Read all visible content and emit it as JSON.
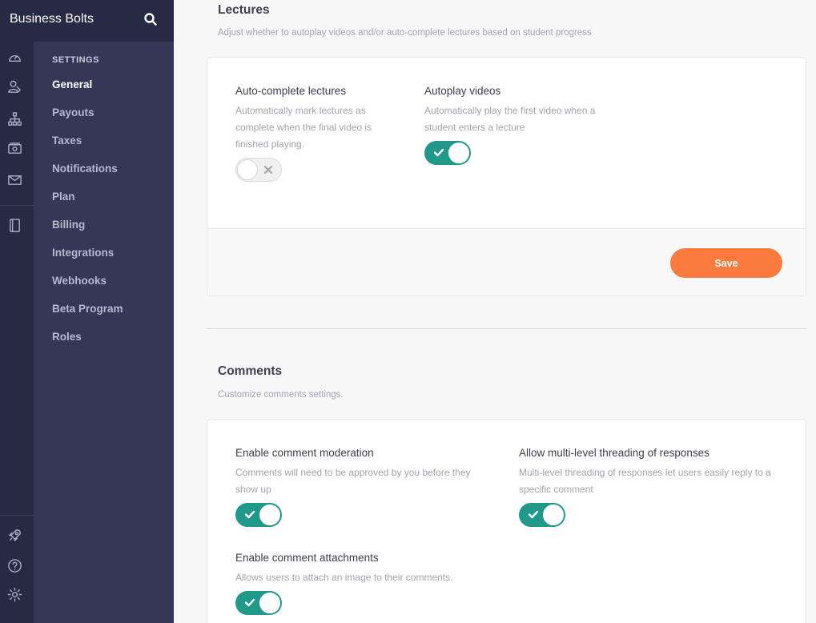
{
  "app": {
    "brand_name": "Business Bolts",
    "search_icon": "search-icon"
  },
  "rail": {
    "top_icons": [
      "dashboard-icon",
      "users-icon",
      "sitemap-icon",
      "money-icon",
      "mail-icon",
      "book-icon"
    ],
    "bottom_icons": [
      "rocket-icon",
      "help-icon",
      "gear-icon"
    ]
  },
  "menu": {
    "heading": "SETTINGS",
    "items": [
      {
        "label": "General",
        "active": true
      },
      {
        "label": "Payouts",
        "active": false
      },
      {
        "label": "Taxes",
        "active": false
      },
      {
        "label": "Notifications",
        "active": false
      },
      {
        "label": "Plan",
        "active": false
      },
      {
        "label": "Billing",
        "active": false
      },
      {
        "label": "Integrations",
        "active": false
      },
      {
        "label": "Webhooks",
        "active": false
      },
      {
        "label": "Beta Program",
        "active": false
      },
      {
        "label": "Roles",
        "active": false
      }
    ]
  },
  "lectures": {
    "title": "Lectures",
    "description": "Adjust whether to autoplay videos and/or auto-complete lectures based on student progress",
    "auto_complete": {
      "label": "Auto-complete lectures",
      "description": "Automatically mark lectures as complete when the final video is finished playing.",
      "enabled": false
    },
    "autoplay": {
      "label": "Autoplay videos",
      "description": "Automatically play the first video when a student enters a lecture",
      "enabled": true
    },
    "save_label": "Save"
  },
  "comments": {
    "title": "Comments",
    "description": "Customize comments settings.",
    "moderation": {
      "label": "Enable comment moderation",
      "description": "Comments will need to be approved by you before they show up",
      "enabled": true
    },
    "threading": {
      "label": "Allow multi-level threading of responses",
      "description": "Multi-level threading of responses let users easily reply to a specific comment",
      "enabled": true
    },
    "attachments": {
      "label": "Enable comment attachments",
      "description": "Allows users to attach an image to their comments.",
      "enabled": true
    }
  },
  "colors": {
    "rail_bg": "#272a44",
    "menu_bg": "#343755",
    "toggle_on": "#20998a",
    "save_button": "#fb7a3d"
  }
}
